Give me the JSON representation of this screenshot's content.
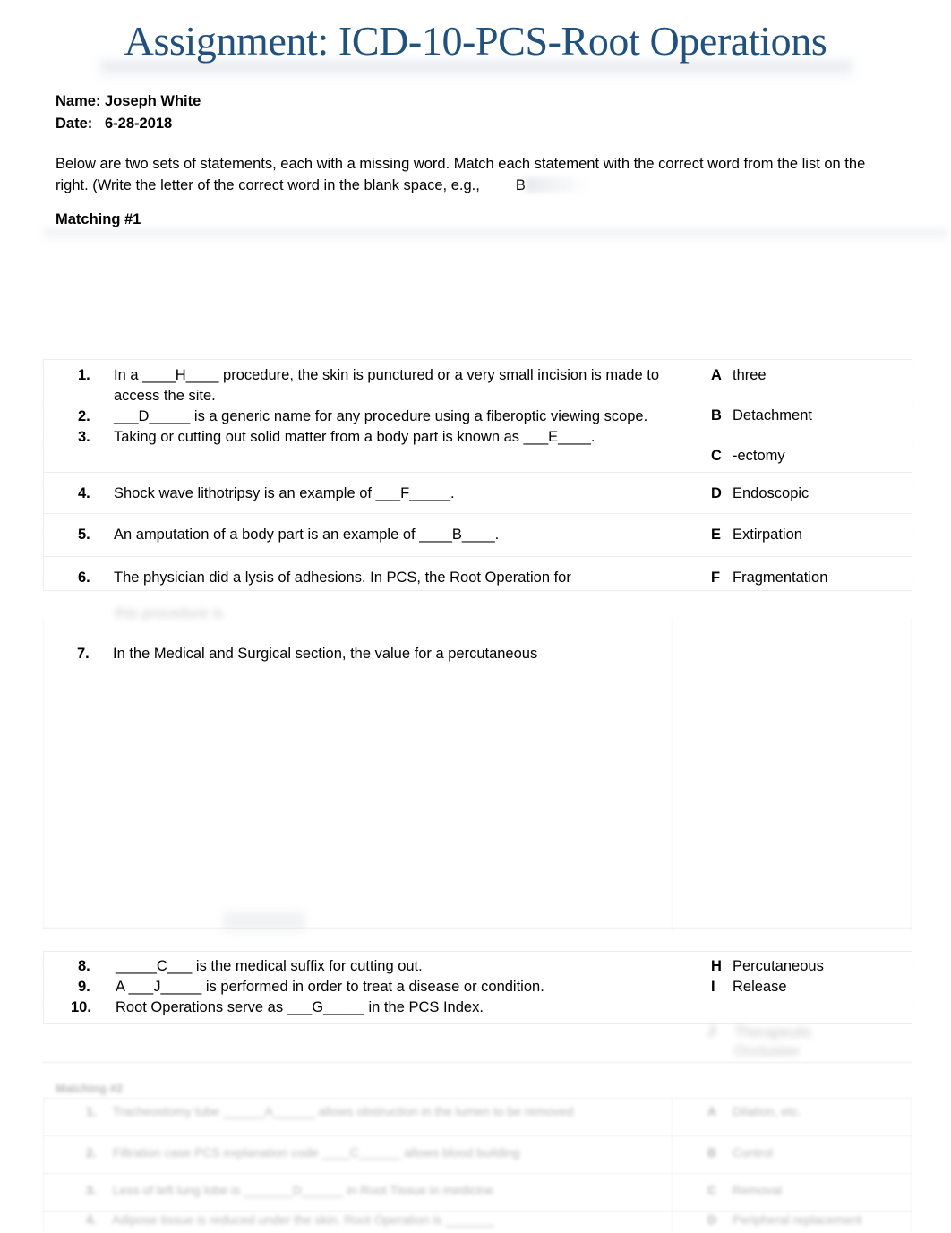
{
  "document": {
    "title": "Assignment: ICD-10-PCS-Root Operations",
    "title_color": "#21517F",
    "page_background": "#ffffff"
  },
  "meta": {
    "name_label": "Name:",
    "name_value": "Joseph White",
    "name_line": "Name: Joseph White",
    "date_label": "Date:",
    "date_value": "6-28-2018",
    "date_line": "Date:   6-28-2018"
  },
  "intro": {
    "line1": "Below are two sets of statements, each with a missing word. Match each statement with the correct word from",
    "line2_before": "the list on the right. (Write the letter of the correct word in the blank space, e.g.,",
    "example_letter": "B"
  },
  "sections": {
    "matching1_label": "Matching #1",
    "matching2_label": "Matching #2"
  },
  "matching1": {
    "questions": [
      {
        "num": "1.",
        "text": "In a ____H____ procedure, the skin is punctured or a very small incision is made to access the site.",
        "answer_filled": "H"
      },
      {
        "num": "2.",
        "text": "___D_____ is a generic name for any procedure using a fiberoptic viewing scope.",
        "answer_filled": "D"
      },
      {
        "num": "3.",
        "text": "Taking or cutting out solid matter from a body part is known as ___E____.",
        "answer_filled": "E"
      },
      {
        "num": "4.",
        "text": "Shock wave lithotripsy is an example of ___F_____.",
        "answer_filled": "F"
      },
      {
        "num": "5.",
        "text": "An amputation of a body part is an example of ____B____.",
        "answer_filled": "B"
      },
      {
        "num": "6.",
        "text": "The physician did a lysis of adhesions. In PCS, the Root Operation for",
        "answer_filled": ""
      },
      {
        "num": "7.",
        "text": "In the Medical and Surgical section, the value for a percutaneous",
        "answer_filled": ""
      },
      {
        "num": "8.",
        "text": "_____C___ is the medical suffix for cutting out.",
        "answer_filled": "C"
      },
      {
        "num": "9.",
        "text": "A ___J_____ is performed in order to treat a disease or condition.",
        "answer_filled": "J"
      },
      {
        "num": "10.",
        "text": "Root Operations serve as ___G_____ in the PCS Index.",
        "answer_filled": "G"
      }
    ],
    "answers": [
      {
        "letter": "A",
        "word": "three"
      },
      {
        "letter": "B",
        "word": "Detachment"
      },
      {
        "letter": "C",
        "word": "-ectomy"
      },
      {
        "letter": "D",
        "word": "Endoscopic"
      },
      {
        "letter": "E",
        "word": "Extirpation"
      },
      {
        "letter": "F",
        "word": "Fragmentation"
      },
      {
        "letter": "H",
        "word": "Percutaneous"
      },
      {
        "letter": "I",
        "word": "Release"
      }
    ]
  },
  "matching2": {
    "note": "This section is rendered faded / out of focus in the screenshot; text is not legible.",
    "questions": [
      {
        "num": "1.",
        "text": ""
      },
      {
        "num": "2.",
        "text": ""
      },
      {
        "num": "3.",
        "text": ""
      },
      {
        "num": "4.",
        "text": ""
      }
    ],
    "answers": [
      {
        "letter": "A",
        "word": ""
      },
      {
        "letter": "B",
        "word": ""
      },
      {
        "letter": "C",
        "word": ""
      },
      {
        "letter": "D",
        "word": ""
      }
    ]
  }
}
